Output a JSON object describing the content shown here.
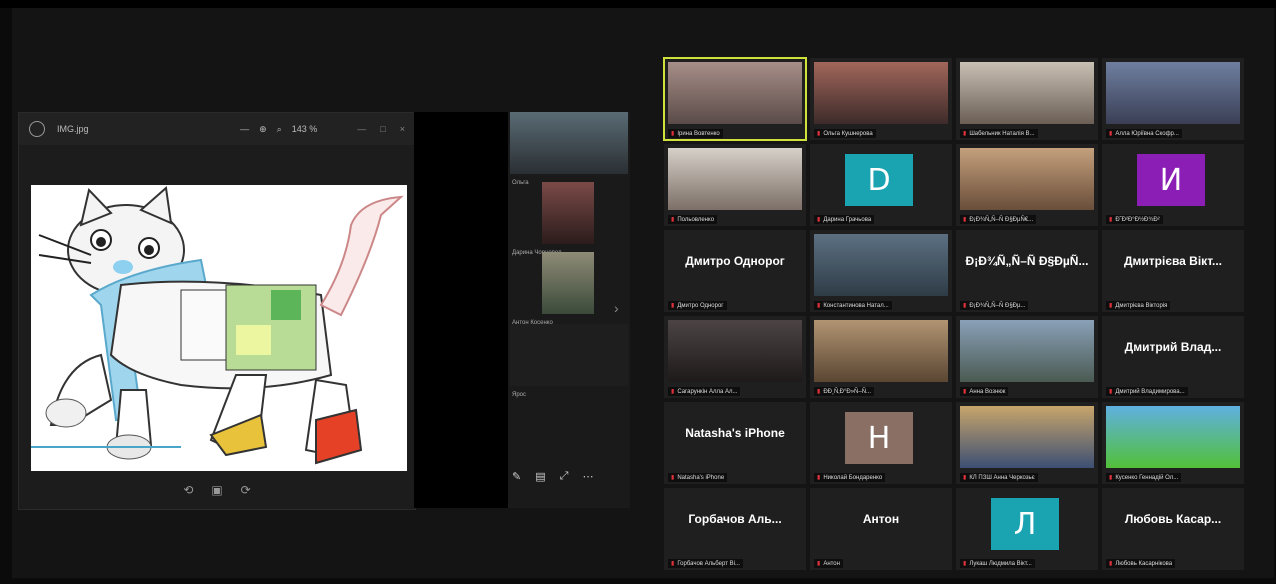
{
  "viewer": {
    "title": "IMG.jpg",
    "zoom": "143 %",
    "footer_icons": [
      "rotate-left-icon",
      "crop-icon",
      "rotate-right-icon"
    ]
  },
  "strip": {
    "thumbs": [
      {
        "label": "Ольга"
      },
      {
        "label": "Дарина Чорновол"
      },
      {
        "label": "Антон Косенко"
      },
      {
        "label": "Ярос"
      }
    ]
  },
  "participants": [
    {
      "name": "Ірина Вовтенко",
      "big": "",
      "avatar": "",
      "color": "",
      "active": true
    },
    {
      "name": "Ольга Кушнерова",
      "big": "",
      "avatar": "",
      "color": "",
      "active": false
    },
    {
      "name": "Шабельник Наталія В...",
      "big": "",
      "avatar": "",
      "color": "",
      "active": false
    },
    {
      "name": "Алла Юріївна Скофр...",
      "big": "",
      "avatar": "",
      "color": "",
      "active": false
    },
    {
      "name": "Польовленко",
      "big": "",
      "avatar": "",
      "color": "",
      "active": false
    },
    {
      "name": "Дарина Грачьова",
      "big": "",
      "avatar": "D",
      "color": "#1aa3b0",
      "active": false
    },
    {
      "name": "Ð¡Ð¾Ñ„Ñ–Ñ Ð§ÐµÑ€...",
      "big": "",
      "avatar": "",
      "color": "",
      "active": false
    },
    {
      "name": "Ð˜Ð²Ð°Ð½Ð¾Ð²",
      "big": "",
      "avatar": "И",
      "color": "#8b1fb5",
      "active": false
    },
    {
      "name": "Дмитро Однорог",
      "big": "Дмитро Однорог",
      "avatar": "",
      "color": "",
      "active": false
    },
    {
      "name": "Константинова Натал...",
      "big": "",
      "avatar": "",
      "color": "",
      "active": false
    },
    {
      "name": "Ð¡Ð¾Ñ„Ñ–Ñ Ð§Ðµ...",
      "big": "Ð¡Ð¾Ñ„Ñ–Ñ Ð§ÐµÑ...",
      "avatar": "",
      "color": "",
      "active": false
    },
    {
      "name": "Дмитрієва Вікторія",
      "big": "Дмитрієва Вікт...",
      "avatar": "",
      "color": "",
      "active": false
    },
    {
      "name": "Сагарункін Алла Ал...",
      "big": "",
      "avatar": "",
      "color": "",
      "active": false
    },
    {
      "name": "ÐÐ¸Ñ‚Ð°Ð»Ñ–Ñ...",
      "big": "",
      "avatar": "",
      "color": "",
      "active": false
    },
    {
      "name": "Анна Вознюк",
      "big": "",
      "avatar": "",
      "color": "",
      "active": false
    },
    {
      "name": "Дмитрий Владимирова...",
      "big": "Дмитрий Влад...",
      "avatar": "",
      "color": "",
      "active": false
    },
    {
      "name": "Natasha's iPhone",
      "big": "Natasha's iPhone",
      "avatar": "",
      "color": "",
      "active": false
    },
    {
      "name": "Николай Бондаренко",
      "big": "",
      "avatar": "Н",
      "color": "#8a6f64",
      "active": false
    },
    {
      "name": "КЛ ПЗШ Анна Черкозьє",
      "big": "",
      "avatar": "",
      "color": "",
      "active": false
    },
    {
      "name": "Кусенко Геннадій Ол...",
      "big": "",
      "avatar": "",
      "color": "",
      "active": false
    },
    {
      "name": "Горбачов Альберт Ві...",
      "big": "Горбачов Аль...",
      "avatar": "",
      "color": "",
      "active": false
    },
    {
      "name": "Антон",
      "big": "Антон",
      "avatar": "",
      "color": "",
      "active": false
    },
    {
      "name": "Лукаш Людмила Вікт...",
      "big": "",
      "avatar": "Л",
      "color": "#1aa3b0",
      "active": false
    },
    {
      "name": "Любовь Касарнікова",
      "big": "Любовь Касар...",
      "avatar": "",
      "color": "",
      "active": false
    }
  ]
}
